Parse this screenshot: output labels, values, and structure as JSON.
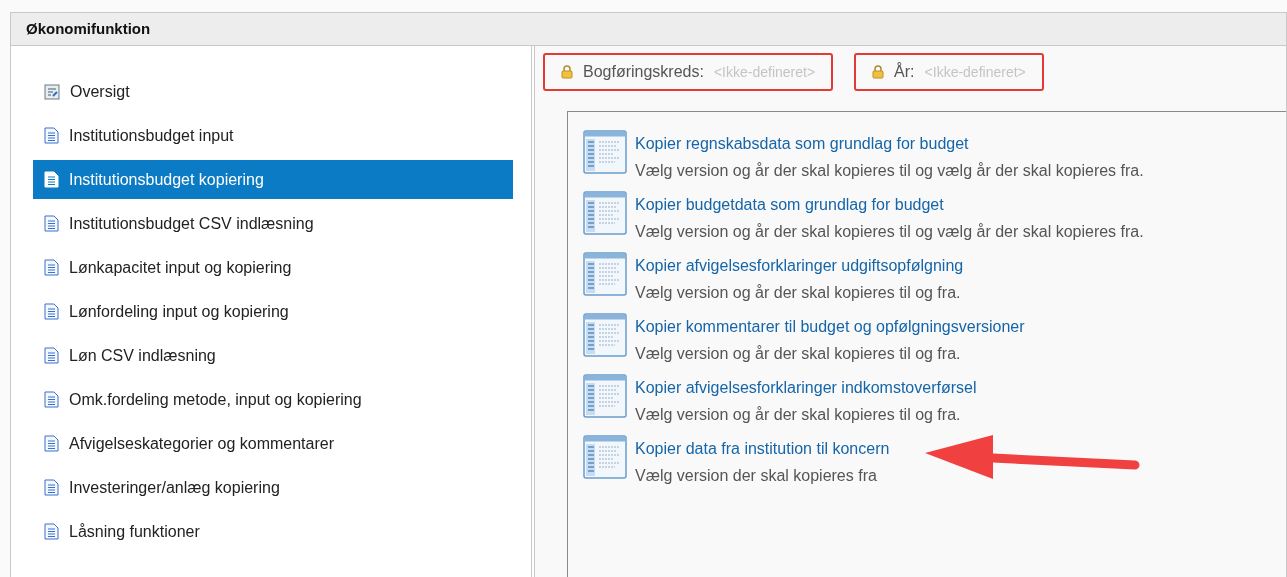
{
  "panel": {
    "title": "Økonomifunktion"
  },
  "nav": [
    {
      "label": "Oversigt",
      "kind": "overview",
      "selected": false
    },
    {
      "label": "Institutionsbudget input",
      "kind": "document",
      "selected": false
    },
    {
      "label": "Institutionsbudget kopiering",
      "kind": "document",
      "selected": true
    },
    {
      "label": "Institutionsbudget CSV indlæsning",
      "kind": "document",
      "selected": false
    },
    {
      "label": "Lønkapacitet input og kopiering",
      "kind": "document",
      "selected": false
    },
    {
      "label": "Lønfordeling input og kopiering",
      "kind": "document",
      "selected": false
    },
    {
      "label": "Løn CSV indlæsning",
      "kind": "document",
      "selected": false
    },
    {
      "label": "Omk.fordeling metode, input og kopiering",
      "kind": "document",
      "selected": false
    },
    {
      "label": "Afvigelseskategorier og kommentarer",
      "kind": "document",
      "selected": false
    },
    {
      "label": "Investeringer/anlæg kopiering",
      "kind": "document",
      "selected": false
    },
    {
      "label": "Låsning funktioner",
      "kind": "document",
      "selected": false
    }
  ],
  "filters": [
    {
      "label": "Bogføringskreds:",
      "value": "<Ikke-defineret>"
    },
    {
      "label": "År:",
      "value": "<Ikke-defineret>"
    }
  ],
  "actions": [
    {
      "title": "Kopier regnskabsdata som grundlag for budget",
      "description": "Vælg version og år der skal kopieres til og vælg år der skal kopieres fra.",
      "highlighted": false
    },
    {
      "title": "Kopier budgetdata som grundlag for budget",
      "description": "Vælg version og år der skal kopieres til og vælg år der skal kopieres fra.",
      "highlighted": false
    },
    {
      "title": "Kopier afvigelsesforklaringer udgiftsopfølgning",
      "description": "Vælg version og år der skal kopieres til og fra.",
      "highlighted": false
    },
    {
      "title": "Kopier kommentarer til budget og opfølgningsversioner",
      "description": "Vælg version og år der skal kopieres til og fra.",
      "highlighted": false
    },
    {
      "title": "Kopier afvigelsesforklaringer indkomstoverførsel",
      "description": "Vælg version og år der skal kopieres til og fra.",
      "highlighted": false
    },
    {
      "title": "Kopier data fra institution til koncern",
      "description": "Vælg version der skal kopieres fra",
      "highlighted": true
    }
  ]
}
